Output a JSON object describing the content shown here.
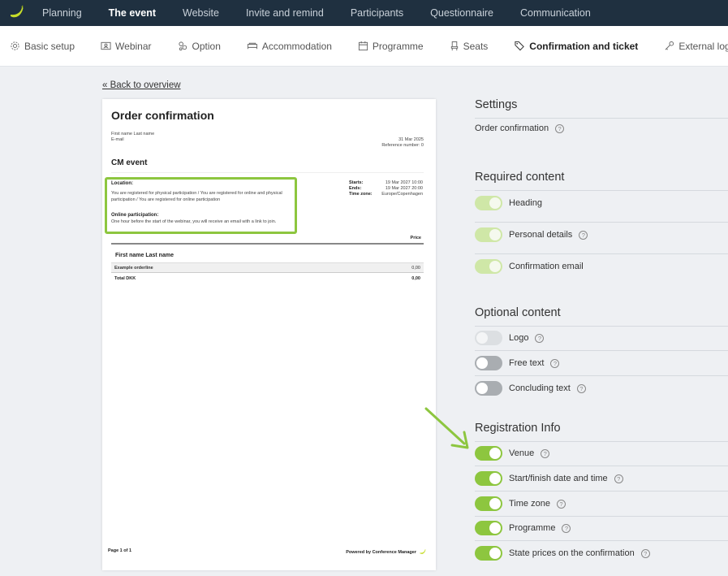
{
  "top_nav": {
    "tabs": [
      {
        "label": "Planning"
      },
      {
        "label": "The event"
      },
      {
        "label": "Website"
      },
      {
        "label": "Invite and remind"
      },
      {
        "label": "Participants"
      },
      {
        "label": "Questionnaire"
      },
      {
        "label": "Communication"
      }
    ],
    "active_tab": "The event"
  },
  "sub_nav": {
    "tabs": [
      {
        "label": "Basic setup",
        "icon": "gear-icon"
      },
      {
        "label": "Webinar",
        "icon": "webinar-icon"
      },
      {
        "label": "Option",
        "icon": "option-icon"
      },
      {
        "label": "Accommodation",
        "icon": "bed-icon"
      },
      {
        "label": "Programme",
        "icon": "calendar-icon"
      },
      {
        "label": "Seats",
        "icon": "seat-icon"
      },
      {
        "label": "Confirmation and ticket",
        "icon": "ticket-icon"
      },
      {
        "label": "External login",
        "icon": "key-icon"
      }
    ],
    "active_tab": "Confirmation and ticket"
  },
  "back_link": "« Back to overview",
  "preview": {
    "title": "Order confirmation",
    "name_line": "First name Last name",
    "email_line": "E-mail",
    "date": "31 Mar 2025",
    "reference": "Reference number: 0",
    "event_name": "CM event",
    "location_label": "Location:",
    "location_text": "You are registered for physical participation / You are registered for online and physical participation / You are registered for online participation",
    "online_label": "Online participation:",
    "online_text": "One hour before the start of the webinar, you will receive an email with a link to join.",
    "starts_label": "Starts:",
    "starts_value": "19 Mar 2027 10:00",
    "ends_label": "Ends:",
    "ends_value": "19 Mar 2027 20:00",
    "timezone_label": "Time zone:",
    "timezone_value": "Europe/Copenhagen",
    "price_header": "Price",
    "attendee_name": "First name Last name",
    "order_line_label": "Example orderline",
    "order_line_price": "0,00",
    "total_label": "Total DKK",
    "total_value": "0,00",
    "page_info": "Page 1 of 1",
    "powered_by": "Powered by Conference Manager"
  },
  "settings": {
    "title": "Settings",
    "order_confirmation": "Order confirmation"
  },
  "required_content": {
    "title": "Required content",
    "items": [
      {
        "label": "Heading",
        "state": "on",
        "locked": true,
        "help": false
      },
      {
        "label": "Personal details",
        "state": "on",
        "locked": true,
        "help": true
      },
      {
        "label": "Confirmation email",
        "state": "on",
        "locked": true,
        "help": false
      }
    ]
  },
  "optional_content": {
    "title": "Optional content",
    "items": [
      {
        "label": "Logo",
        "state": "off",
        "locked": true,
        "help": true
      },
      {
        "label": "Free text",
        "state": "off",
        "locked": false,
        "help": true
      },
      {
        "label": "Concluding text",
        "state": "off",
        "locked": false,
        "help": true
      }
    ]
  },
  "registration_info": {
    "title": "Registration Info",
    "items": [
      {
        "label": "Venue",
        "state": "on",
        "help": true
      },
      {
        "label": "Start/finish date and time",
        "state": "on",
        "help": true
      },
      {
        "label": "Time zone",
        "state": "on",
        "help": true
      },
      {
        "label": "Programme",
        "state": "on",
        "help": true
      },
      {
        "label": "State prices on the confirmation",
        "state": "on",
        "help": true
      }
    ]
  },
  "colors": {
    "nav_bg": "#1f3040",
    "accent_green": "#8dc63f",
    "page_bg": "#eef0f3"
  }
}
